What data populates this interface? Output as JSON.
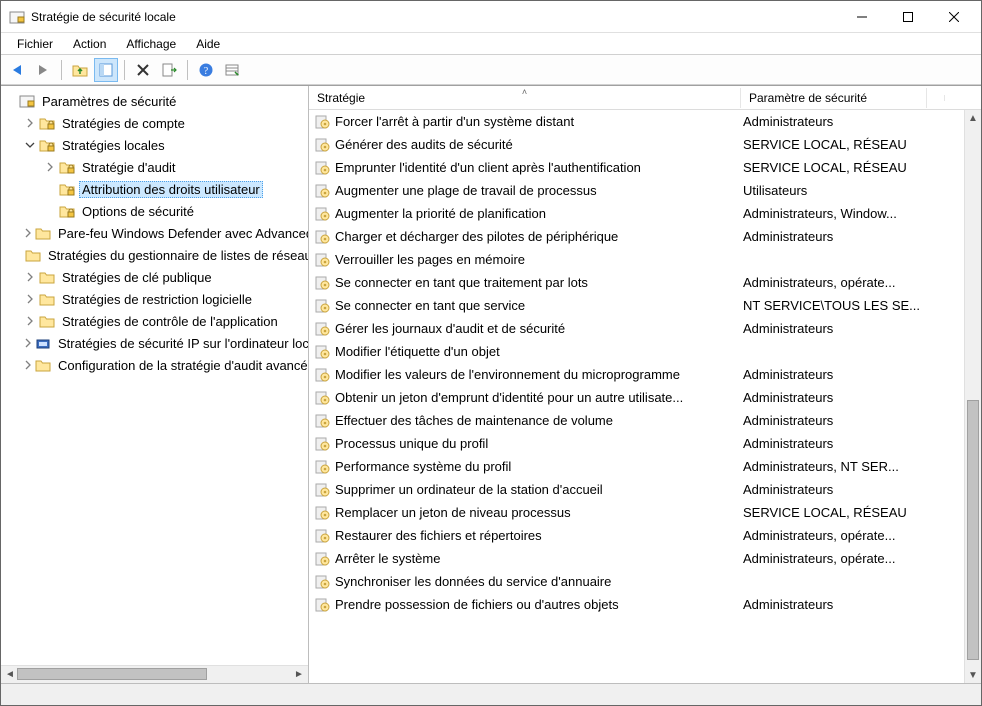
{
  "window": {
    "title": "Stratégie de sécurité locale"
  },
  "menu": {
    "file": "Fichier",
    "action": "Action",
    "view": "Affichage",
    "help": "Aide"
  },
  "toolbar_icons": {
    "back": "back-arrow",
    "forward": "forward-arrow",
    "up": "up-folder",
    "refresh": "refresh",
    "delete": "delete",
    "export": "export",
    "help": "help",
    "details": "details-view"
  },
  "tree": {
    "root": {
      "label": "Paramètres de sécurité"
    },
    "items": [
      {
        "label": "Stratégies de compte",
        "depth": 1,
        "expander": ">",
        "icon": "folder-locked"
      },
      {
        "label": "Stratégies locales",
        "depth": 1,
        "expander": "v",
        "icon": "folder-locked"
      },
      {
        "label": "Stratégie d'audit",
        "depth": 2,
        "expander": ">",
        "icon": "folder-locked"
      },
      {
        "label": "Attribution des droits utilisateur",
        "depth": 2,
        "expander": "",
        "icon": "folder-locked",
        "selected": true
      },
      {
        "label": "Options de sécurité",
        "depth": 2,
        "expander": "",
        "icon": "folder-locked"
      },
      {
        "label": "Pare-feu Windows Defender avec Advanced Security",
        "depth": 1,
        "expander": ">",
        "icon": "folder"
      },
      {
        "label": "Stratégies du gestionnaire de listes de réseaux",
        "depth": 1,
        "expander": "",
        "icon": "folder"
      },
      {
        "label": "Stratégies de clé publique",
        "depth": 1,
        "expander": ">",
        "icon": "folder"
      },
      {
        "label": "Stratégies de restriction logicielle",
        "depth": 1,
        "expander": ">",
        "icon": "folder"
      },
      {
        "label": "Stratégies de contrôle de l'application",
        "depth": 1,
        "expander": ">",
        "icon": "folder"
      },
      {
        "label": "Stratégies de sécurité IP sur l'ordinateur local",
        "depth": 1,
        "expander": ">",
        "icon": "ipsec"
      },
      {
        "label": "Configuration de la stratégie d'audit avancée",
        "depth": 1,
        "expander": ">",
        "icon": "folder"
      }
    ]
  },
  "list": {
    "columns": {
      "policy": "Stratégie",
      "setting": "Paramètre de sécurité"
    },
    "rows": [
      {
        "policy": "Forcer l'arrêt à partir d'un système distant",
        "setting": "Administrateurs"
      },
      {
        "policy": "Générer des audits de sécurité",
        "setting": "SERVICE LOCAL, RÉSEAU"
      },
      {
        "policy": "Emprunter l'identité d'un client après l'authentification",
        "setting": "SERVICE LOCAL, RÉSEAU"
      },
      {
        "policy": "Augmenter une plage de travail de processus",
        "setting": "Utilisateurs"
      },
      {
        "policy": "Augmenter la priorité de planification",
        "setting": "Administrateurs, Window..."
      },
      {
        "policy": "Charger et décharger des pilotes de périphérique",
        "setting": "Administrateurs"
      },
      {
        "policy": "Verrouiller les pages en mémoire",
        "setting": ""
      },
      {
        "policy": "Se connecter en tant que traitement par lots",
        "setting": "Administrateurs, opérate..."
      },
      {
        "policy": "Se connecter en tant que service",
        "setting": "NT SERVICE\\TOUS LES SE..."
      },
      {
        "policy": "Gérer les journaux d'audit et de sécurité",
        "setting": "Administrateurs"
      },
      {
        "policy": "Modifier l'étiquette d'un objet",
        "setting": ""
      },
      {
        "policy": "Modifier les valeurs de l'environnement du microprogramme",
        "setting": "Administrateurs"
      },
      {
        "policy": "Obtenir un jeton d'emprunt d'identité pour un autre utilisate...",
        "setting": "Administrateurs"
      },
      {
        "policy": "Effectuer des tâches de maintenance de volume",
        "setting": "Administrateurs"
      },
      {
        "policy": "Processus unique du profil",
        "setting": "Administrateurs"
      },
      {
        "policy": "Performance système du profil",
        "setting": "Administrateurs, NT SER..."
      },
      {
        "policy": "Supprimer un ordinateur de la station d'accueil",
        "setting": "Administrateurs"
      },
      {
        "policy": "Remplacer un jeton de niveau processus",
        "setting": "SERVICE LOCAL, RÉSEAU"
      },
      {
        "policy": "Restaurer des fichiers et répertoires",
        "setting": "Administrateurs, opérate..."
      },
      {
        "policy": "Arrêter le système",
        "setting": "Administrateurs, opérate..."
      },
      {
        "policy": "Synchroniser les données du service d'annuaire",
        "setting": ""
      },
      {
        "policy": "Prendre possession de fichiers ou d'autres objets",
        "setting": "Administrateurs"
      }
    ]
  }
}
